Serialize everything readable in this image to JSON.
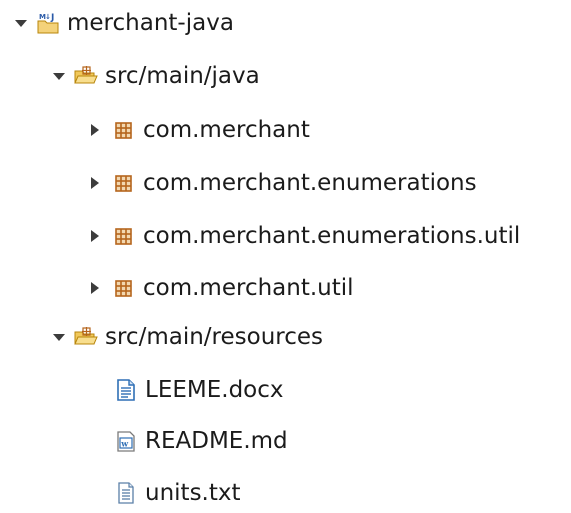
{
  "tree": {
    "project": {
      "label": "merchant-java",
      "icon": "java-project-icon",
      "expanded": true
    },
    "source_folders": [
      {
        "label": "src/main/java",
        "icon": "source-folder-icon",
        "expanded": true,
        "children": [
          {
            "label": "com.merchant",
            "icon": "package-icon",
            "expanded": false
          },
          {
            "label": "com.merchant.enumerations",
            "icon": "package-icon",
            "expanded": false
          },
          {
            "label": "com.merchant.enumerations.util",
            "icon": "package-icon",
            "expanded": false
          },
          {
            "label": "com.merchant.util",
            "icon": "package-icon",
            "expanded": false
          }
        ]
      },
      {
        "label": "src/main/resources",
        "icon": "source-folder-icon",
        "expanded": true,
        "children": [
          {
            "label": "LEEME.docx",
            "icon": "document-file-icon"
          },
          {
            "label": "README.md",
            "icon": "wiki-file-icon"
          },
          {
            "label": "units.txt",
            "icon": "text-file-icon"
          }
        ]
      }
    ]
  },
  "colors": {
    "package_icon": "#b5651d",
    "folder_icon": "#e8b94a",
    "twisty": "#3c3c3c",
    "text": "#1b1b1b"
  }
}
